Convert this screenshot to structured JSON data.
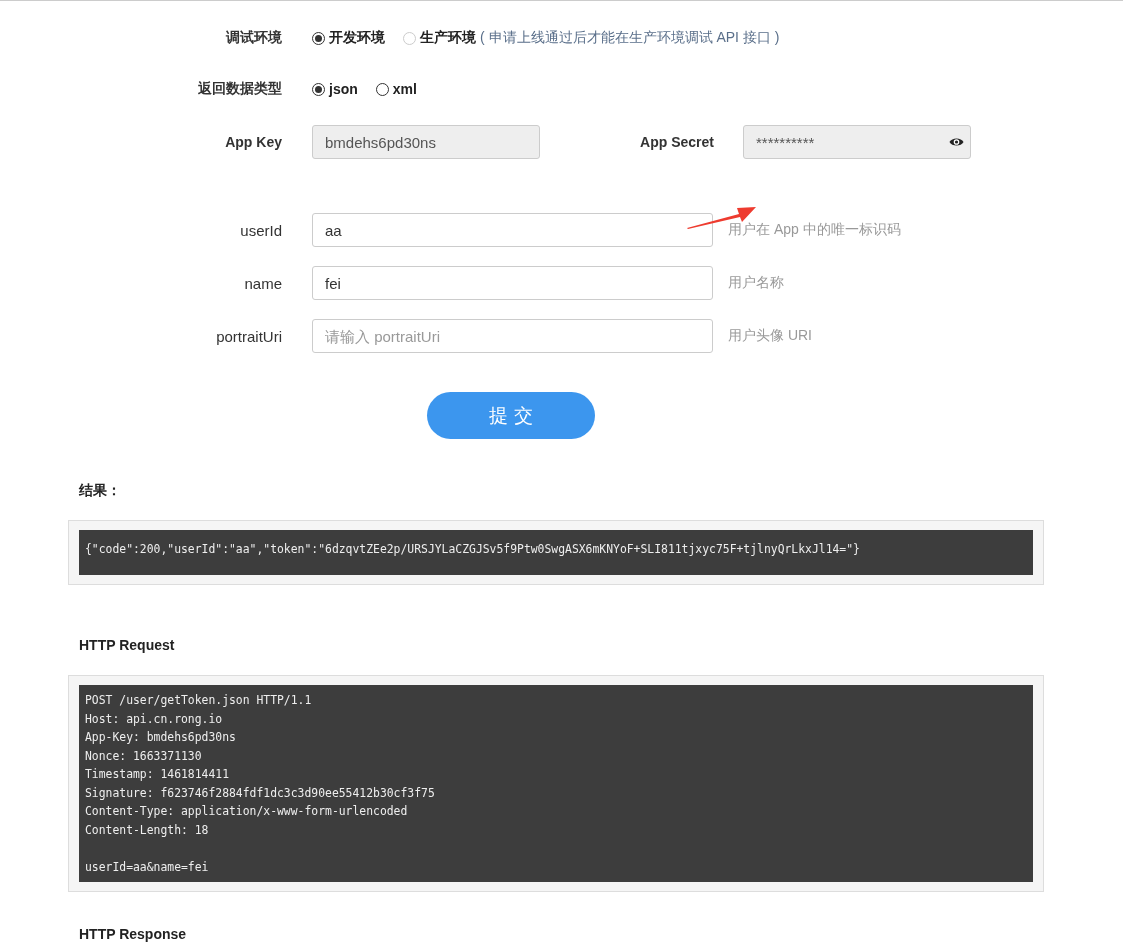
{
  "settings": [
    {
      "label": "调试环境",
      "kind": "radio",
      "options": [
        {
          "label": "开发环境",
          "selected": true,
          "disabled": false
        },
        {
          "label": "生产环境",
          "selected": false,
          "disabled": true
        }
      ],
      "note": "( 申请上线通过后才能在生产环境调试 API 接口 )"
    },
    {
      "label": "返回数据类型",
      "kind": "radio",
      "options": [
        {
          "label": "json",
          "selected": true,
          "disabled": false
        },
        {
          "label": "xml",
          "selected": false,
          "disabled": false
        }
      ]
    }
  ],
  "credentials": [
    {
      "label": "App Key",
      "value": "bmdehs6pd30ns",
      "masked": false
    },
    {
      "label": "App Secret",
      "value": "**********",
      "masked": true
    }
  ],
  "fields": [
    {
      "label": "userId",
      "value": "aa",
      "hint": "用户在 App 中的唯一标识码"
    },
    {
      "label": "name",
      "value": "fei",
      "hint": "用户名称"
    },
    {
      "label": "portraitUri",
      "placeholder": "请输入 portraitUri",
      "hint": "用户头像 URI"
    }
  ],
  "submit_button": "提 交",
  "result": {
    "title": "结果：",
    "body": "{\"code\":200,\"userId\":\"aa\",\"token\":\"6dzqvtZEe2p/URSJYLaCZGJSv5f9Ptw0SwgASX6mKNYoF+SLI811tjxyc75F+tjlnyQrLkxJl14=\"}"
  },
  "request": {
    "title": "HTTP Request",
    "body": "POST /user/getToken.json HTTP/1.1\nHost: api.cn.rong.io\nApp-Key: bmdehs6pd30ns\nNonce: 1663371130\nTimestamp: 1461814411\nSignature: f623746f2884fdf1dc3c3d90ee55412b30cf3f75\nContent-Type: application/x-www-form-urlencoded\nContent-Length: 18\n\nuserId=aa&name=fei"
  },
  "response": {
    "title": "HTTP Response"
  }
}
